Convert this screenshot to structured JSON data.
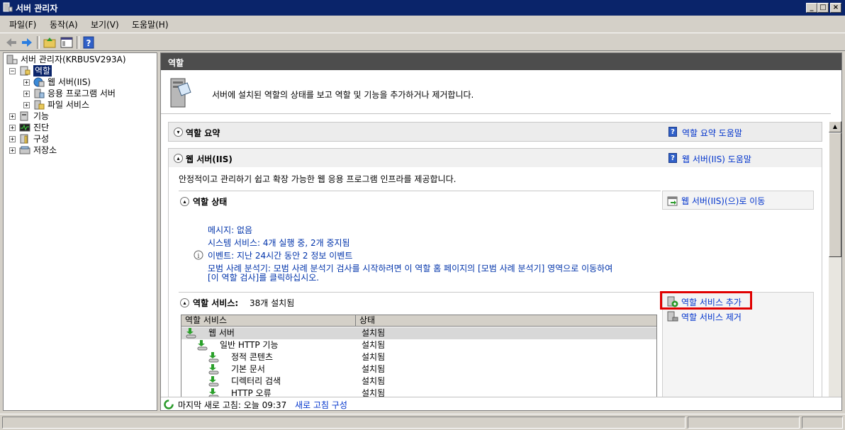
{
  "window": {
    "title": "서버 관리자"
  },
  "menu": [
    "파일(F)",
    "동작(A)",
    "보기(V)",
    "도움말(H)"
  ],
  "tree": {
    "root": "서버 관리자(KRBUSV293A)",
    "roles": "역할",
    "web_server": "웹 서버(IIS)",
    "app_server": "응용 프로그램 서버",
    "file_services": "파일 서비스",
    "features": "기능",
    "diagnostics": "진단",
    "configuration": "구성",
    "storage": "저장소"
  },
  "pane": {
    "header": "역할",
    "intro": "서버에 설치된 역할의 상태를 보고 역할 및 기능을 추가하거나 제거합니다.",
    "roles_summary": {
      "title": "역할 요약",
      "help": "역할 요약 도움말"
    },
    "web_server": {
      "title": "웹 서버(IIS)",
      "help": "웹 서버(IIS) 도움말",
      "description": "안정적이고 관리하기 쉽고 확장 가능한 웹 응용 프로그램 인프라를 제공합니다."
    },
    "role_status": {
      "title": "역할 상태",
      "goto": "웹 서버(IIS)(으)로 이동",
      "messages": "메시지: 없음",
      "system_services": "시스템 서비스: 4개 실행 중, 2개 중지됨",
      "events": "이벤트: 지난 24시간 동안 2 정보 이벤트",
      "bpa_line1": "모범 사례 분석기: 모범 사례 분석기 검사를 시작하려면 이 역할 홈 페이지의 [모범 사례 분석기] 영역으로 이동하여",
      "bpa_line2": "[이 역할 검사]를 클릭하십시오."
    },
    "role_services": {
      "title": "역할 서비스:",
      "count": "38개 설치됨",
      "add": "역할 서비스 추가",
      "remove": "역할 서비스 제거",
      "col_service": "역할 서비스",
      "col_status": "상태",
      "rows": [
        {
          "name": "웹 서버",
          "status": "설치됨"
        },
        {
          "name": "일반 HTTP 기능",
          "status": "설치됨"
        },
        {
          "name": "정적 콘텐츠",
          "status": "설치됨"
        },
        {
          "name": "기본 문서",
          "status": "설치됨"
        },
        {
          "name": "디렉터리 검색",
          "status": "설치됨"
        },
        {
          "name": "HTTP 오류",
          "status": "설치됨"
        }
      ]
    },
    "footer": {
      "last_refresh": "마지막 새로 고침: 오늘 09:37",
      "configure": "새로 고침 구성"
    }
  },
  "colors": {
    "titlebar": "#0a246a",
    "highlight_box": "#e00000",
    "link": "#0033cc",
    "header_bg": "#4d4d4d"
  }
}
